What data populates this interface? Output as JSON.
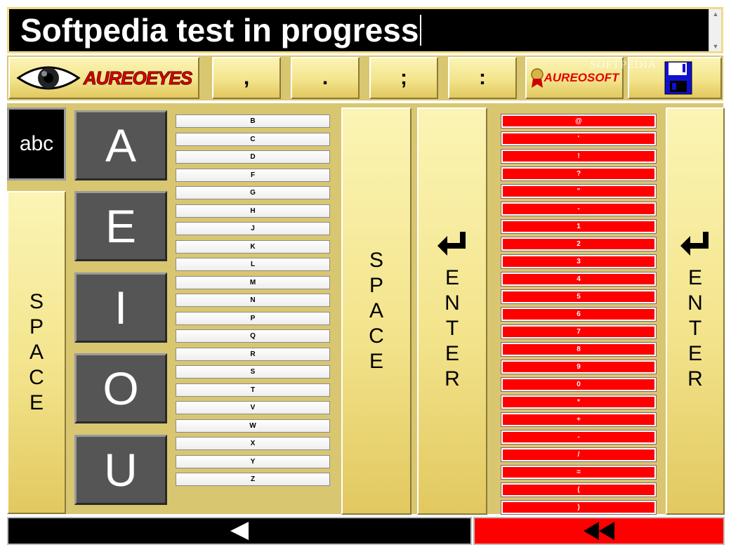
{
  "text_field": {
    "value": "Softpedia test in progress"
  },
  "toolbar": {
    "logo_left": "AUREOEYES",
    "punctuation": [
      ",",
      ".",
      ";",
      ":"
    ],
    "logo_right": "AUREOSOFT",
    "watermark": "SOFTPEDIA"
  },
  "keyboard": {
    "case_toggle": "abc",
    "space_label": "SPACE",
    "enter_label": "ENTER",
    "vowels": [
      "A",
      "E",
      "I",
      "O",
      "U"
    ],
    "consonants": [
      "B",
      "C",
      "D",
      "F",
      "G",
      "H",
      "J",
      "K",
      "L",
      "M",
      "N",
      "P",
      "Q",
      "R",
      "S",
      "T",
      "V",
      "W",
      "X",
      "Y",
      "Z"
    ],
    "symbols": [
      "@",
      "'",
      "!",
      "?",
      "\"",
      "-",
      "1",
      "2",
      "3",
      "4",
      "5",
      "6",
      "7",
      "8",
      "9",
      "0",
      "*",
      "+",
      "-",
      "/",
      "=",
      "(",
      ")"
    ]
  },
  "colors": {
    "accent": "#ff0000",
    "panel": "#f3e48c",
    "dark_key": "#555555",
    "text_bg": "#000000"
  },
  "icons": {
    "enter": "enter-arrow-icon",
    "back": "backspace-triangle-icon",
    "rewind": "rewind-icon",
    "save": "floppy-disk-icon",
    "eye": "eye-icon"
  }
}
